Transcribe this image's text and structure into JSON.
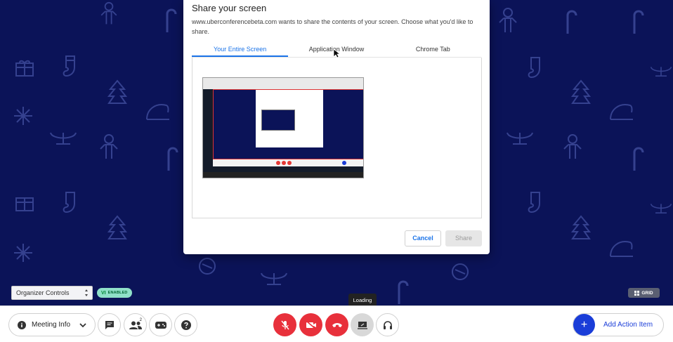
{
  "dialog": {
    "title": "Share your screen",
    "description": "www.uberconferencebeta.com wants to share the contents of your screen. Choose what you'd like to share.",
    "tabs": [
      {
        "label": "Your Entire Screen",
        "active": true
      },
      {
        "label": "Application Window",
        "active": false
      },
      {
        "label": "Chrome Tab",
        "active": false
      }
    ],
    "cancel_label": "Cancel",
    "share_label": "Share"
  },
  "organizer": {
    "select_value": "Organizer Controls",
    "badge_prefix": "VI",
    "badge_text": "ENABLED"
  },
  "grid_label": "GRID",
  "tooltip": "Loading",
  "toolbar": {
    "meeting_info_label": "Meeting Info",
    "participants_count": "2",
    "add_action_label": "Add Action Item"
  },
  "colors": {
    "background": "#0b1358",
    "accent": "#1a73e8",
    "danger": "#e8303b",
    "action": "#1a3dd8"
  }
}
